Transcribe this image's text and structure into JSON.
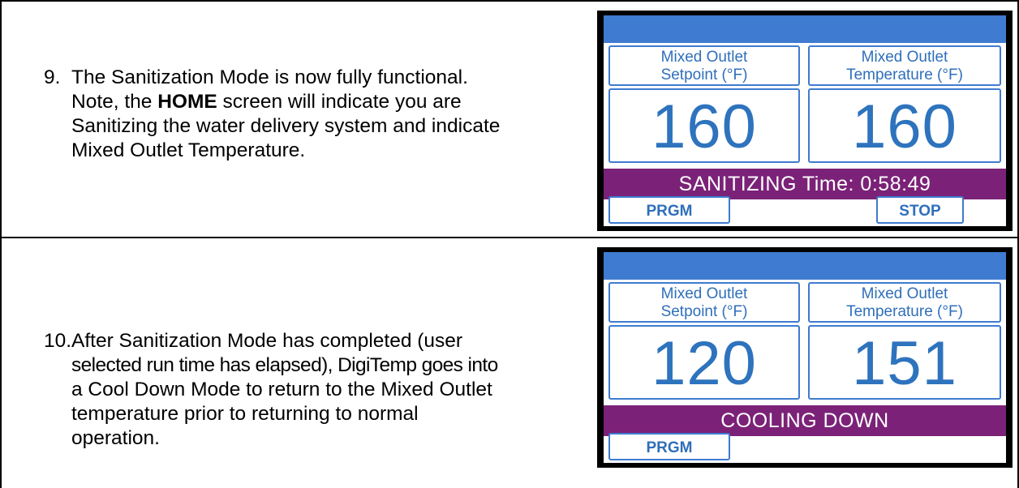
{
  "steps": [
    {
      "number": "9.",
      "lines": [
        "The Sanitization Mode is now fully functional.",
        "Note, the ",
        "HOME",
        " screen will indicate you are",
        "Sanitizing the water delivery system and indicate",
        "Mixed Outlet Temperature."
      ],
      "display": {
        "setpoint_label_1": "Mixed Outlet",
        "setpoint_label_2": "Setpoint (°F)",
        "temperature_label_1": "Mixed Outlet",
        "temperature_label_2": "Temperature (°F)",
        "setpoint_value": "160",
        "temperature_value": "160",
        "status": "SANITIZING Time: 0:58:49",
        "button_left": "PRGM",
        "button_right": "STOP"
      }
    },
    {
      "number": "10.",
      "lines": [
        "After Sanitization Mode has completed (user",
        "selected run time has elapsed), DigiTemp goes into",
        "a Cool Down Mode to return to the Mixed Outlet",
        "temperature prior to returning to normal",
        "operation."
      ],
      "display": {
        "setpoint_label_1": "Mixed Outlet",
        "setpoint_label_2": "Setpoint (°F)",
        "temperature_label_1": "Mixed Outlet",
        "temperature_label_2": "Temperature (°F)",
        "setpoint_value": "120",
        "temperature_value": "151",
        "status": "COOLING DOWN",
        "button_left": "PRGM"
      }
    }
  ],
  "colors": {
    "accent_blue": "#3f7bd0",
    "status_purple": "#7b2278"
  }
}
